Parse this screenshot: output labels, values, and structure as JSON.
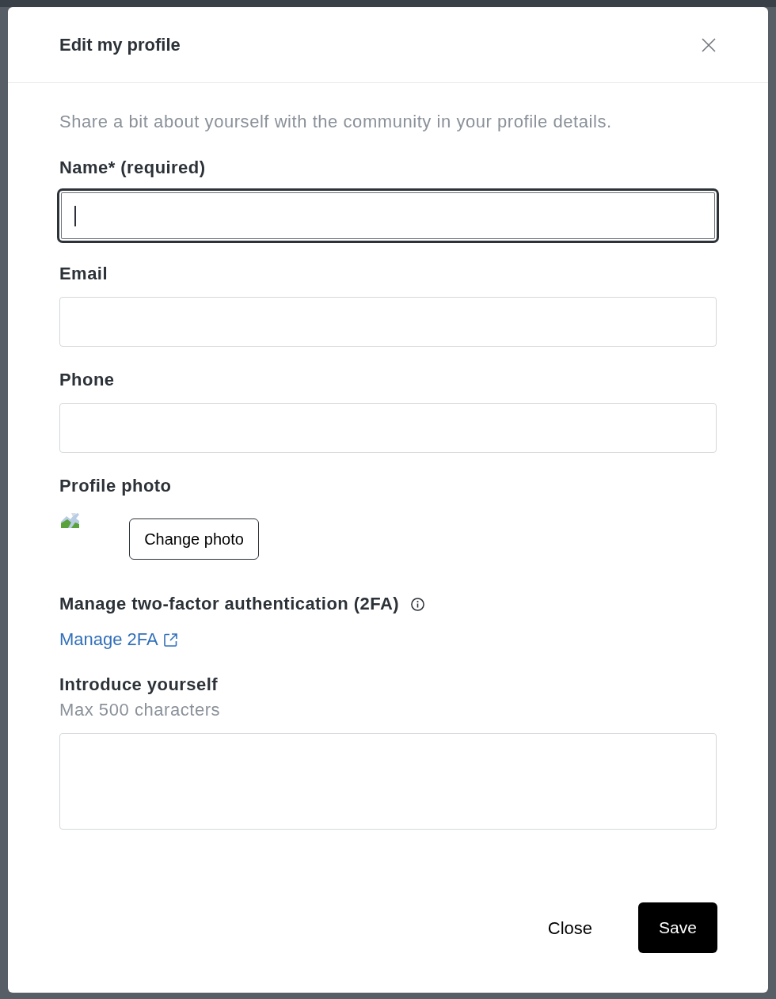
{
  "dialog": {
    "title": "Edit my profile",
    "description": "Share a bit about yourself with the community in your profile details."
  },
  "sections": [
    {
      "kind": "input",
      "label": "Name* (required)",
      "focused": true
    },
    {
      "kind": "input",
      "label": "Email",
      "focused": false
    },
    {
      "kind": "input",
      "label": "Phone",
      "focused": false
    },
    {
      "kind": "photo",
      "label": "Profile photo",
      "button": "Change photo"
    },
    {
      "kind": "link",
      "label": "Manage two-factor authentication (2FA)",
      "link": "Manage 2FA"
    },
    {
      "kind": "textarea",
      "label": "Introduce yourself",
      "hint": "Max 500 characters"
    }
  ],
  "footer": {
    "buttons": [
      {
        "label": "Close",
        "kind": "secondary"
      },
      {
        "label": "Save",
        "kind": "primary"
      }
    ]
  }
}
